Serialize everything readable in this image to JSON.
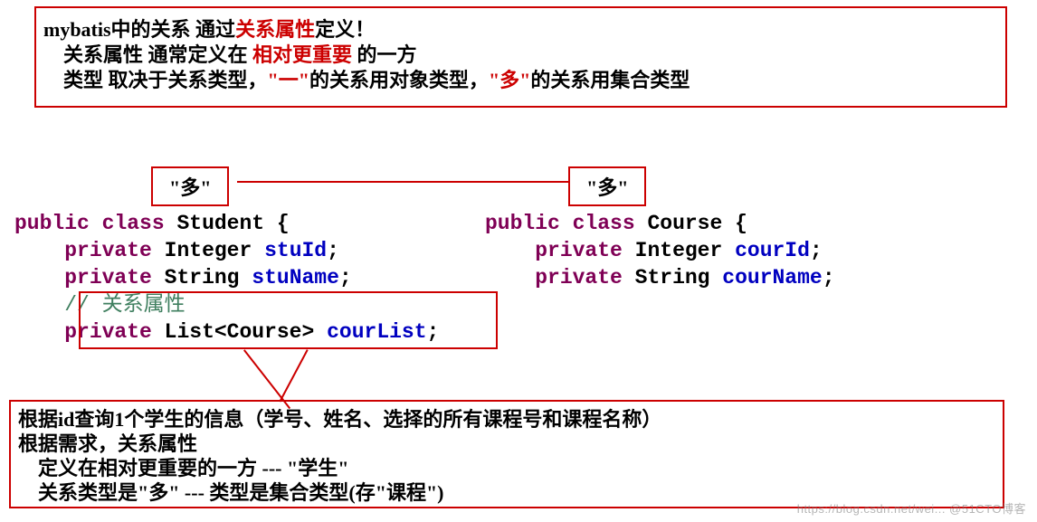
{
  "topBox": {
    "line1": {
      "pre": "mybatis中的关系 通过",
      "red": "关系属性",
      "post": "定义！"
    },
    "line2": {
      "pre": "    关系属性 通常定义在 ",
      "red": "相对更重要",
      "post": " 的一方"
    },
    "line3": {
      "pre": "    类型 取决于关系类型，",
      "red1": "\"一\"",
      "mid": "的关系用对象类型，",
      "red2": "\"多\"",
      "post": "的关系用集合类型"
    }
  },
  "manyLeft": "\"多\"",
  "manyRight": "\"多\"",
  "student": {
    "l1": {
      "kw1": "public",
      "kw2": "class",
      "name": "Student",
      "brace": "{"
    },
    "l2": {
      "kw": "private",
      "type": "Integer",
      "name": "stuId"
    },
    "l3": {
      "kw": "private",
      "type": "String",
      "name": "stuName"
    },
    "l4": {
      "comment": "// 关系属性"
    },
    "l5": {
      "kw": "private",
      "type": "List<Course>",
      "name": "courList"
    }
  },
  "course": {
    "l1": {
      "kw1": "public",
      "kw2": "class",
      "name": "Course",
      "brace": "{"
    },
    "l2": {
      "kw": "private",
      "type": "Integer",
      "name": "courId"
    },
    "l3": {
      "kw": "private",
      "type": "String",
      "name": "courName"
    }
  },
  "bottomBox": {
    "b1": "根据id查询1个学生的信息（学号、姓名、选择的所有课程号和课程名称）",
    "b2": "根据需求，关系属性",
    "b3": "    定义在相对更重要的一方 --- \"学生\"",
    "b4": "    关系类型是\"多\" --- 类型是集合类型(存\"课程\")"
  },
  "watermark": "https://blog.csdn.net/wei... @51CTO博客"
}
